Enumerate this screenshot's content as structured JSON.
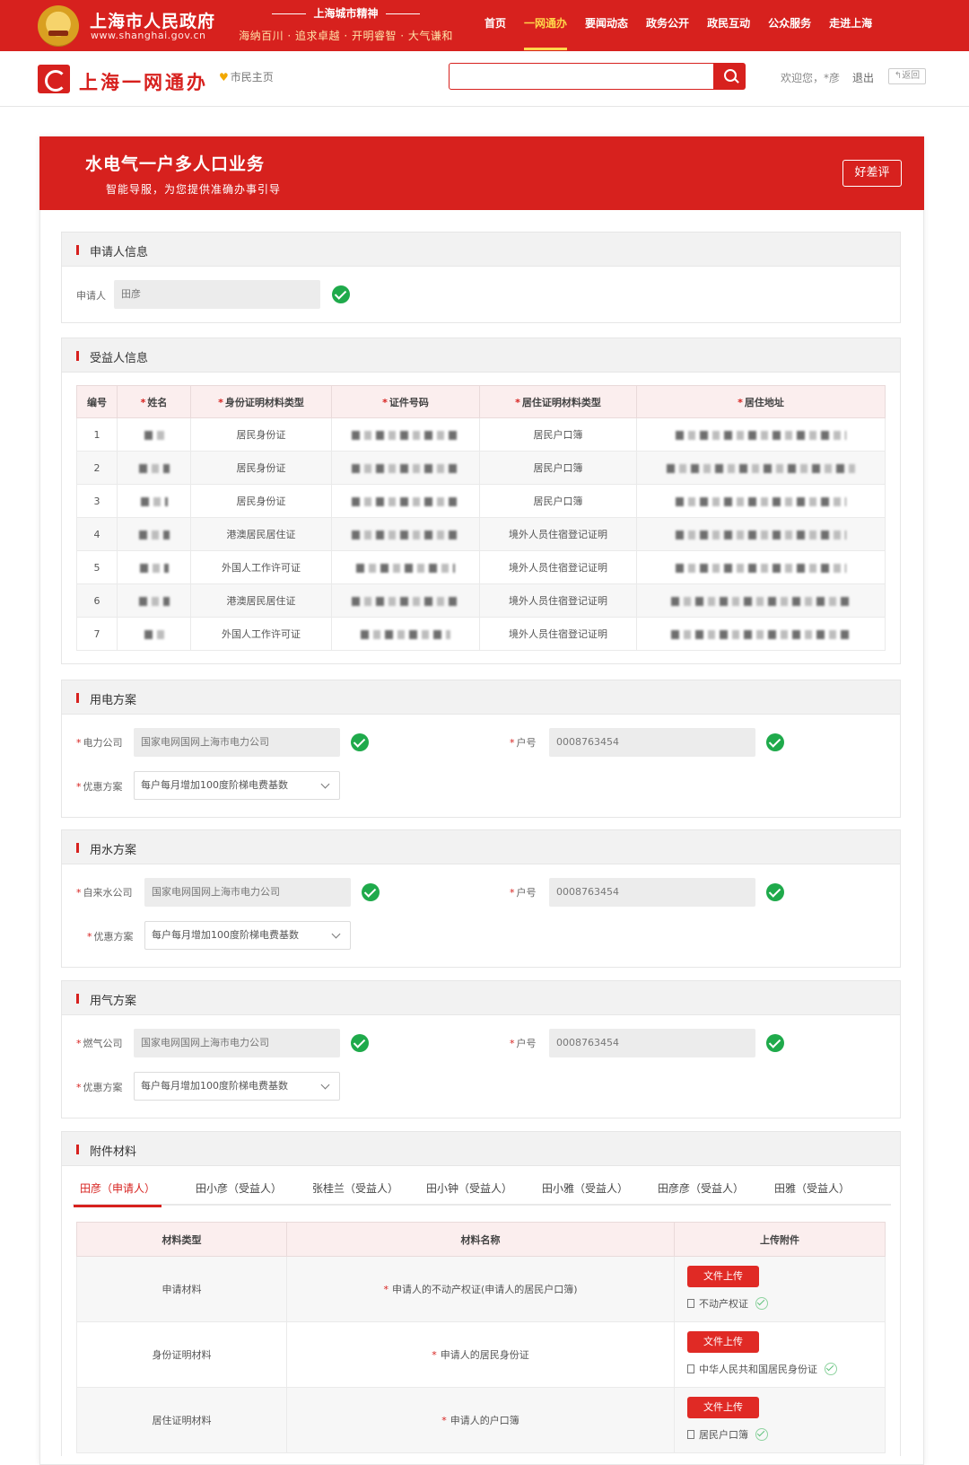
{
  "gov_banner": {
    "name": "上海市人民政府",
    "url": "www.shanghai.gov.cn",
    "spirit_title": "上海城市精神",
    "spirit_slogan": "海纳百川 · 追求卓越 · 开明睿智 · 大气谦和",
    "nav": [
      "首页",
      "一网通办",
      "要闻动态",
      "政务公开",
      "政民互动",
      "公众服务",
      "走进上海"
    ],
    "nav_active": "一网通办"
  },
  "site_header": {
    "title": "上海一网通办",
    "citizen_home": "市民主页",
    "search_placeholder": "",
    "welcome": "欢迎您，*彦",
    "logout": "退出",
    "back": "返回"
  },
  "hero": {
    "title": "水电气一户多人口业务",
    "subtitle": "智能导服，为您提供准确办事引导",
    "rate_button": "好差评"
  },
  "applicant": {
    "section_title": "申请人信息",
    "label": "申请人",
    "value": "田彦"
  },
  "beneficiaries": {
    "section_title": "受益人信息",
    "columns": [
      "编号",
      "姓名",
      "身份证明材料类型",
      "证件号码",
      "居住证明材料类型",
      "居住地址"
    ],
    "rows": [
      {
        "no": "1",
        "id_type": "居民身份证",
        "res_type": "居民户口簿"
      },
      {
        "no": "2",
        "id_type": "居民身份证",
        "res_type": "居民户口簿"
      },
      {
        "no": "3",
        "id_type": "居民身份证",
        "res_type": "居民户口簿"
      },
      {
        "no": "4",
        "id_type": "港澳居民居住证",
        "res_type": "境外人员住宿登记证明"
      },
      {
        "no": "5",
        "id_type": "外国人工作许可证",
        "res_type": "境外人员住宿登记证明"
      },
      {
        "no": "6",
        "id_type": "港澳居民居住证",
        "res_type": "境外人员住宿登记证明"
      },
      {
        "no": "7",
        "id_type": "外国人工作许可证",
        "res_type": "境外人员住宿登记证明"
      }
    ]
  },
  "electricity": {
    "section_title": "用电方案",
    "company_label": "电力公司",
    "company_value": "国家电网国网上海市电力公司",
    "account_label": "户号",
    "account_value": "0008763454",
    "plan_label": "优惠方案",
    "plan_value": "每户每月增加100度阶梯电费基数"
  },
  "water": {
    "section_title": "用水方案",
    "company_label": "自来水公司",
    "company_value": "国家电网国网上海市电力公司",
    "account_label": "户号",
    "account_value": "0008763454",
    "plan_label": "优惠方案",
    "plan_value": "每户每月增加100度阶梯电费基数"
  },
  "gas": {
    "section_title": "用气方案",
    "company_label": "燃气公司",
    "company_value": "国家电网国网上海市电力公司",
    "account_label": "户号",
    "account_value": "0008763454",
    "plan_label": "优惠方案",
    "plan_value": "每户每月增加100度阶梯电费基数"
  },
  "attachments": {
    "section_title": "附件材料",
    "tabs": [
      "田彦（申请人）",
      "田小彦（受益人）",
      "张桂兰（受益人）",
      "田小钟（受益人）",
      "田小雅（受益人）",
      "田彦彦（受益人）",
      "田雅（受益人）"
    ],
    "active_tab": "田彦（申请人）",
    "columns": [
      "材料类型",
      "材料名称",
      "上传附件"
    ],
    "upload_label": "文件上传",
    "rows": [
      {
        "type": "申请材料",
        "name": "申请人的不动产权证(申请人的居民户口簿)",
        "file": "不动产权证"
      },
      {
        "type": "身份证明材料",
        "name": "申请人的居民身份证",
        "file": "中华人民共和国居民身份证"
      },
      {
        "type": "居住证明材料",
        "name": "申请人的户口簿",
        "file": "居民户口簿"
      }
    ]
  },
  "colors": {
    "brand_red": "#d7211e",
    "nav_active": "#ffd54a",
    "ok_green": "#1faa4b"
  }
}
